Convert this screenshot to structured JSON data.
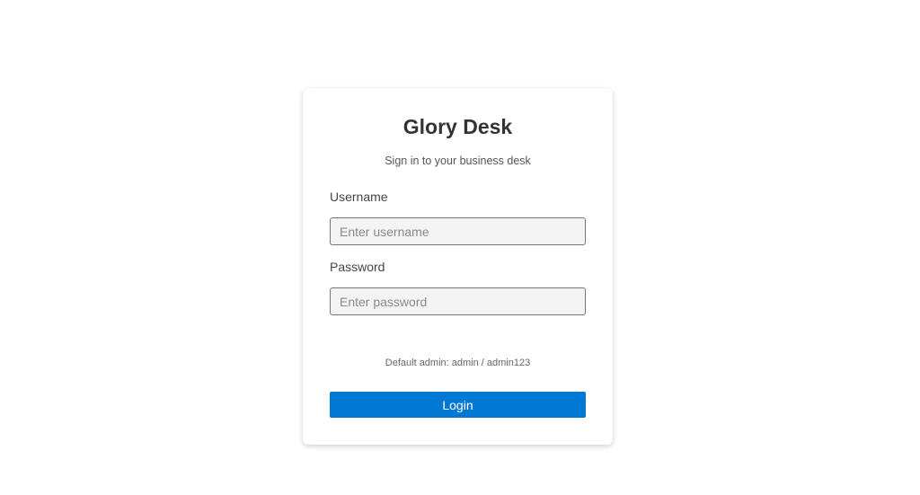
{
  "app": {
    "title": "Glory Desk",
    "subtitle": "Sign in to your business desk"
  },
  "form": {
    "username": {
      "label": "Username",
      "value": "",
      "placeholder": "Enter username"
    },
    "password": {
      "label": "Password",
      "value": "",
      "placeholder": "Enter password"
    },
    "hint": "Default admin: admin / admin123",
    "submit_label": "Login"
  },
  "colors": {
    "accent": "#0078d4",
    "input_bg": "#f3f3f3",
    "title": "#333333"
  }
}
